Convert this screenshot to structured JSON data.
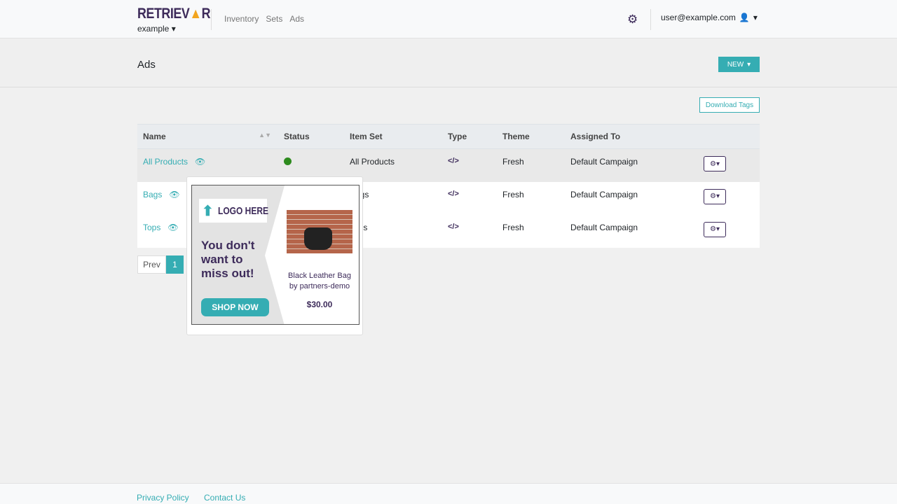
{
  "brand": {
    "logo_text": "RETRIEVER",
    "org": "example"
  },
  "nav": {
    "items": [
      "Inventory",
      "Sets",
      "Ads"
    ]
  },
  "user": {
    "email": "user@example.com"
  },
  "page": {
    "title": "Ads",
    "new_label": "NEW",
    "download_label": "Download Tags"
  },
  "table": {
    "headers": [
      "Name",
      "Status",
      "Item Set",
      "Type",
      "Theme",
      "Assigned To"
    ],
    "rows": [
      {
        "name": "All Products",
        "status": "active",
        "item_set": "All Products",
        "type": "</>",
        "theme": "Fresh",
        "assigned": "Default Campaign"
      },
      {
        "name": "Bags",
        "status": "active",
        "item_set": "Bags",
        "type": "</>",
        "theme": "Fresh",
        "assigned": "Default Campaign"
      },
      {
        "name": "Tops",
        "status": "active",
        "item_set": "Tops",
        "type": "</>",
        "theme": "Fresh",
        "assigned": "Default Campaign"
      }
    ]
  },
  "pagination": {
    "prev": "Prev",
    "current": "1"
  },
  "preview": {
    "logo": "LOGO HERE",
    "headline": "You don't want to miss out!",
    "cta": "SHOP NOW",
    "product": "Black Leather Bag by partners-demo",
    "price": "$30.00"
  },
  "footer": {
    "privacy": "Privacy Policy",
    "contact": "Contact Us"
  },
  "colors": {
    "accent": "#35adb3",
    "brand": "#3d2b5a",
    "status_active": "#2e8b1e"
  }
}
